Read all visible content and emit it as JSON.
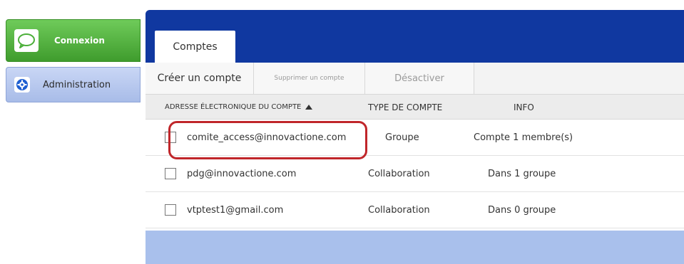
{
  "sidebar": {
    "items": [
      {
        "label": "Connexion",
        "icon": "speech-bubble-icon"
      },
      {
        "label": "Administration",
        "icon": "gear-icon"
      }
    ]
  },
  "main": {
    "tabs": [
      {
        "label": "Comptes",
        "active": true
      }
    ],
    "toolbar": {
      "create_label": "Créer un compte",
      "delete_label": "Supprimer un compte",
      "disable_label": "Désactiver"
    },
    "table": {
      "columns": [
        {
          "label": "Adresse électronique du compte",
          "sorted": "ascending"
        },
        {
          "label": "Type de compte"
        },
        {
          "label": "Info"
        }
      ],
      "rows": [
        {
          "email": "comite_access@innovactione.com",
          "type": "Groupe",
          "info": "Compte 1 membre(s)",
          "checked": false,
          "highlighted": true
        },
        {
          "email": "pdg@innovactione.com",
          "type": "Collaboration",
          "info": "Dans 1 groupe",
          "checked": false,
          "highlighted": false
        },
        {
          "email": "vtptest1@gmail.com",
          "type": "Collaboration",
          "info": "Dans 0 groupe",
          "checked": false,
          "highlighted": false
        }
      ]
    }
  },
  "colors": {
    "header_blue": "#1038a0",
    "panel_bg": "#a9c0ec",
    "connexion_green": "#4caf3a",
    "admin_blue": "#b8c9f0",
    "highlight_red": "#c0262a"
  }
}
